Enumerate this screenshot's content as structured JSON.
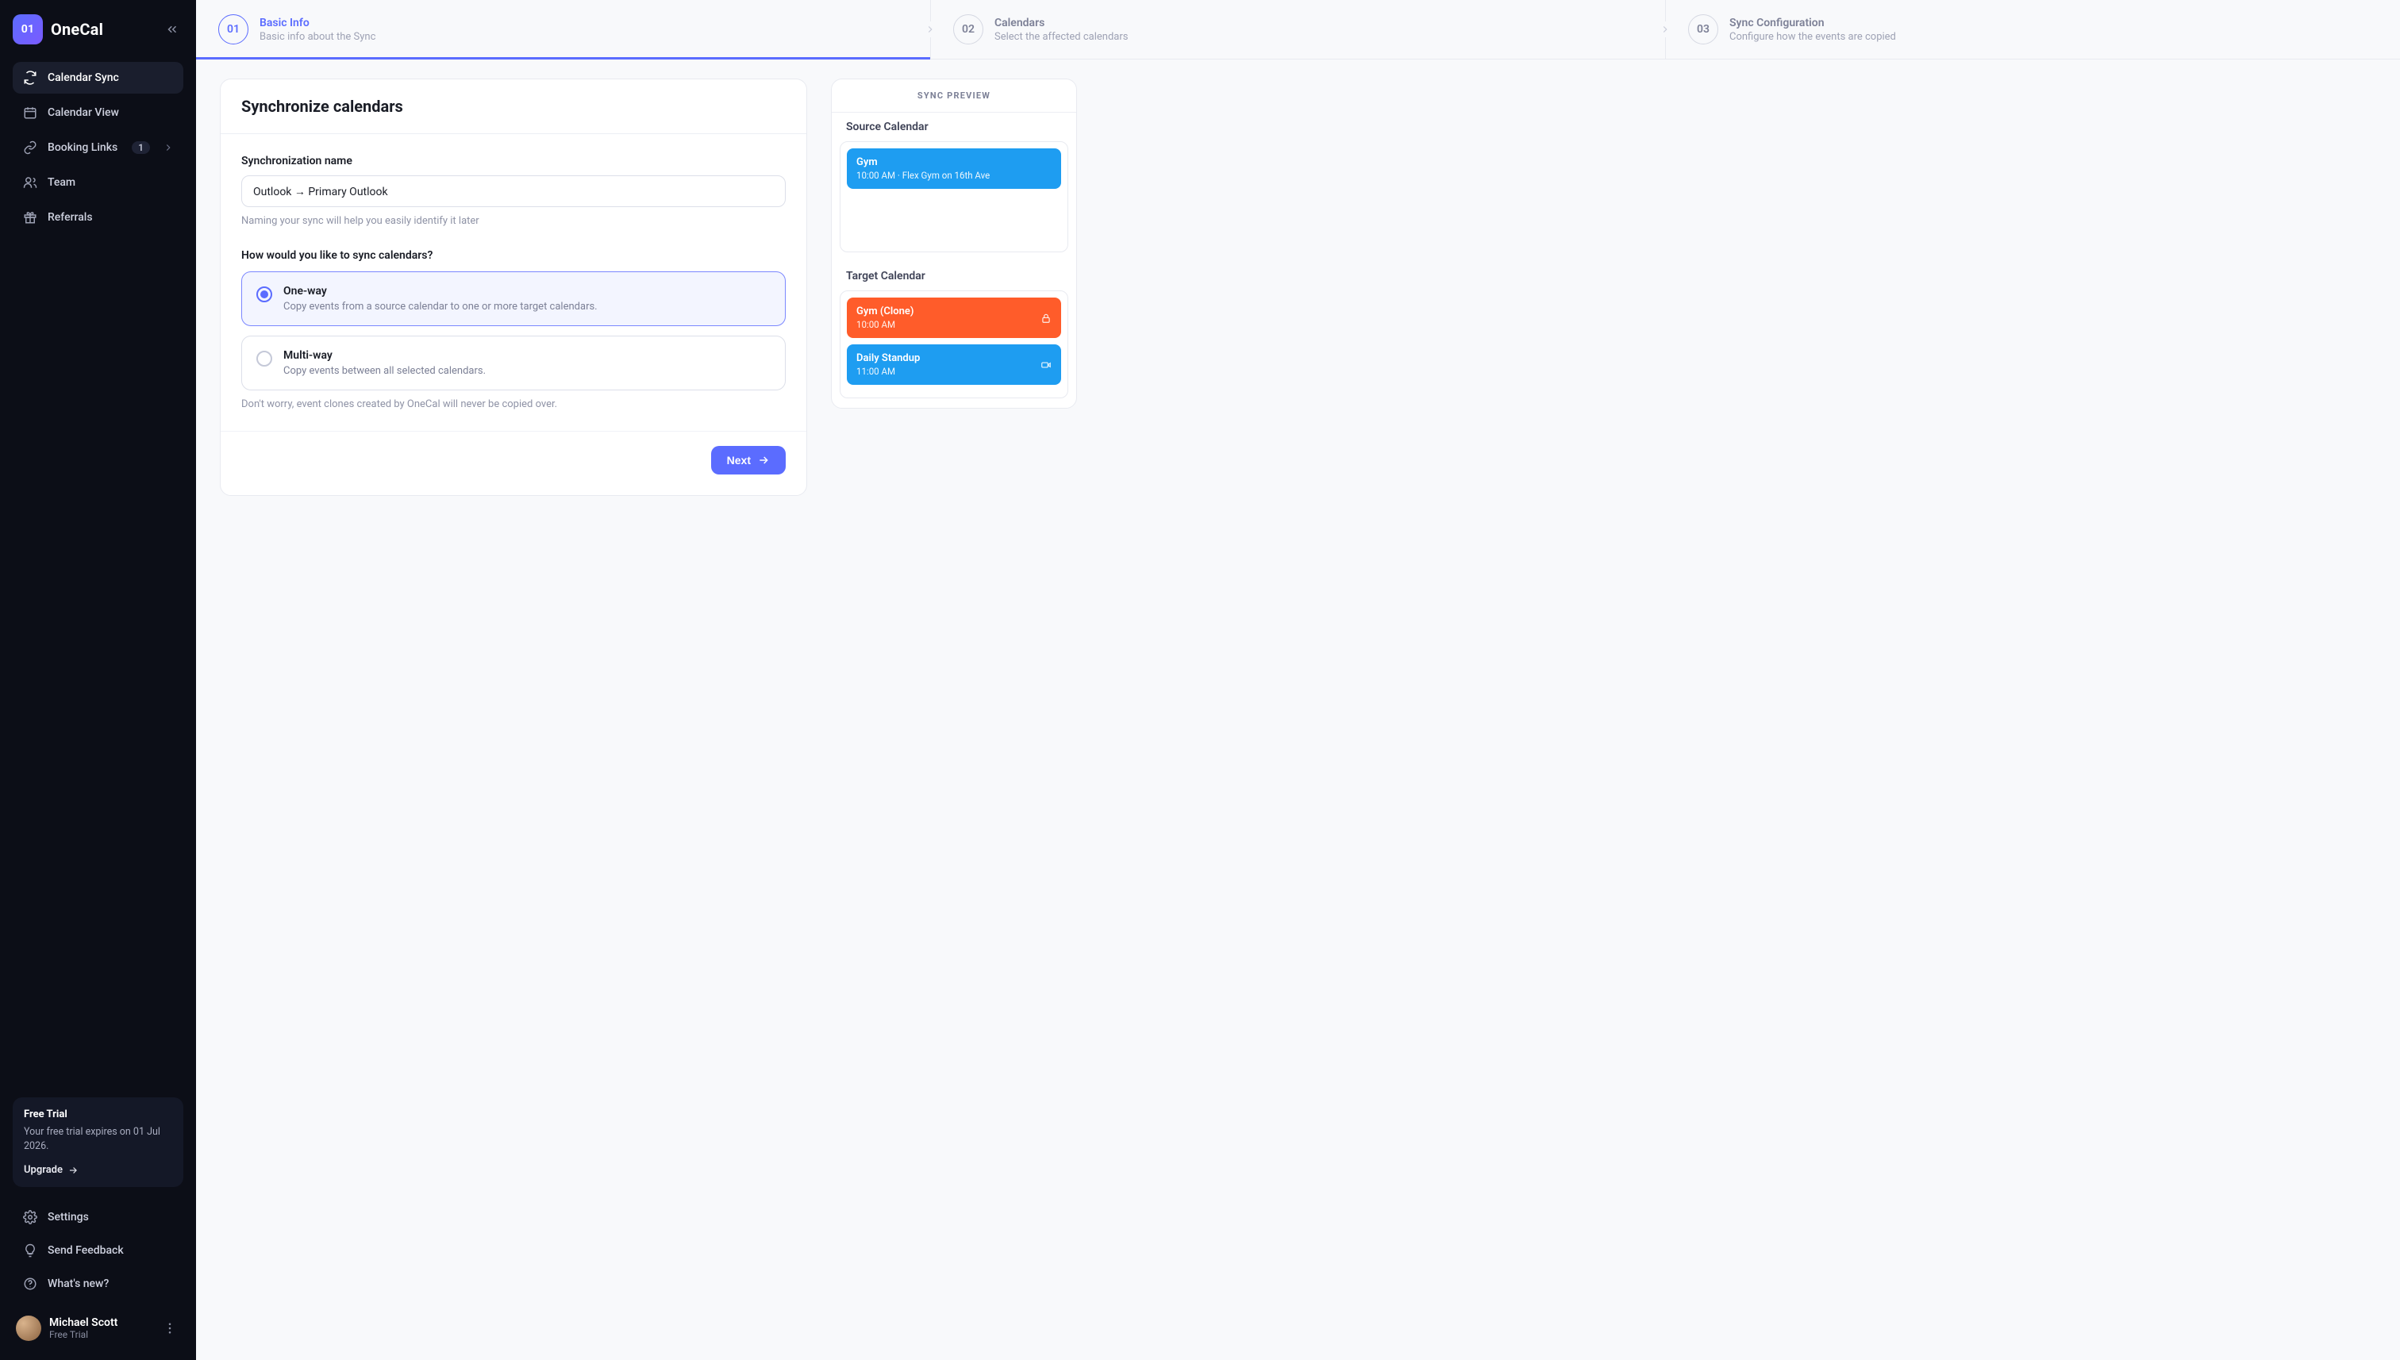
{
  "brand": {
    "name": "OneCal",
    "mark": "01"
  },
  "sidebar": {
    "items": [
      {
        "label": "Calendar Sync",
        "icon": "sync-icon",
        "active": true
      },
      {
        "label": "Calendar View",
        "icon": "calendar-icon"
      },
      {
        "label": "Booking Links",
        "icon": "link-icon",
        "badge": "1",
        "chevron": true
      },
      {
        "label": "Team",
        "icon": "team-icon"
      },
      {
        "label": "Referrals",
        "icon": "gift-icon"
      }
    ],
    "trial": {
      "title": "Free Trial",
      "body": "Your free trial expires on 01 Jul 2026.",
      "upgrade_label": "Upgrade"
    },
    "bottom": [
      {
        "label": "Settings",
        "icon": "gear-icon"
      },
      {
        "label": "Send Feedback",
        "icon": "bulb-icon"
      },
      {
        "label": "What's new?",
        "icon": "help-icon"
      }
    ],
    "user": {
      "name": "Michael Scott",
      "plan": "Free Trial"
    }
  },
  "stepper": {
    "steps": [
      {
        "num": "01",
        "title": "Basic Info",
        "sub": "Basic info about the Sync",
        "active": true
      },
      {
        "num": "02",
        "title": "Calendars",
        "sub": "Select the affected calendars"
      },
      {
        "num": "03",
        "title": "Sync Configuration",
        "sub": "Configure how the events are copied"
      }
    ]
  },
  "form": {
    "card_title": "Synchronize calendars",
    "name_label": "Synchronization name",
    "name_value": "Outlook → Primary Outlook",
    "name_helper": "Naming your sync will help you easily identify it later",
    "sync_how_label": "How would you like to sync calendars?",
    "options": [
      {
        "title": "One-way",
        "desc": "Copy events from a source calendar to one or more target calendars.",
        "selected": true
      },
      {
        "title": "Multi-way",
        "desc": "Copy events between all selected calendars."
      }
    ],
    "options_helper": "Don't worry, event clones created by OneCal will never be copied over.",
    "next_label": "Next"
  },
  "preview": {
    "header": "SYNC PREVIEW",
    "source_label": "Source Calendar",
    "target_label": "Target Calendar",
    "source_events": [
      {
        "title": "Gym",
        "sub": "10:00 AM · Flex Gym on 16th Ave",
        "color": "blue"
      }
    ],
    "target_events": [
      {
        "title": "Gym (Clone)",
        "sub": "10:00 AM",
        "color": "orange",
        "icon": "lock-icon"
      },
      {
        "title": "Daily Standup",
        "sub": "11:00 AM",
        "color": "blue2",
        "icon": "video-icon"
      }
    ]
  }
}
